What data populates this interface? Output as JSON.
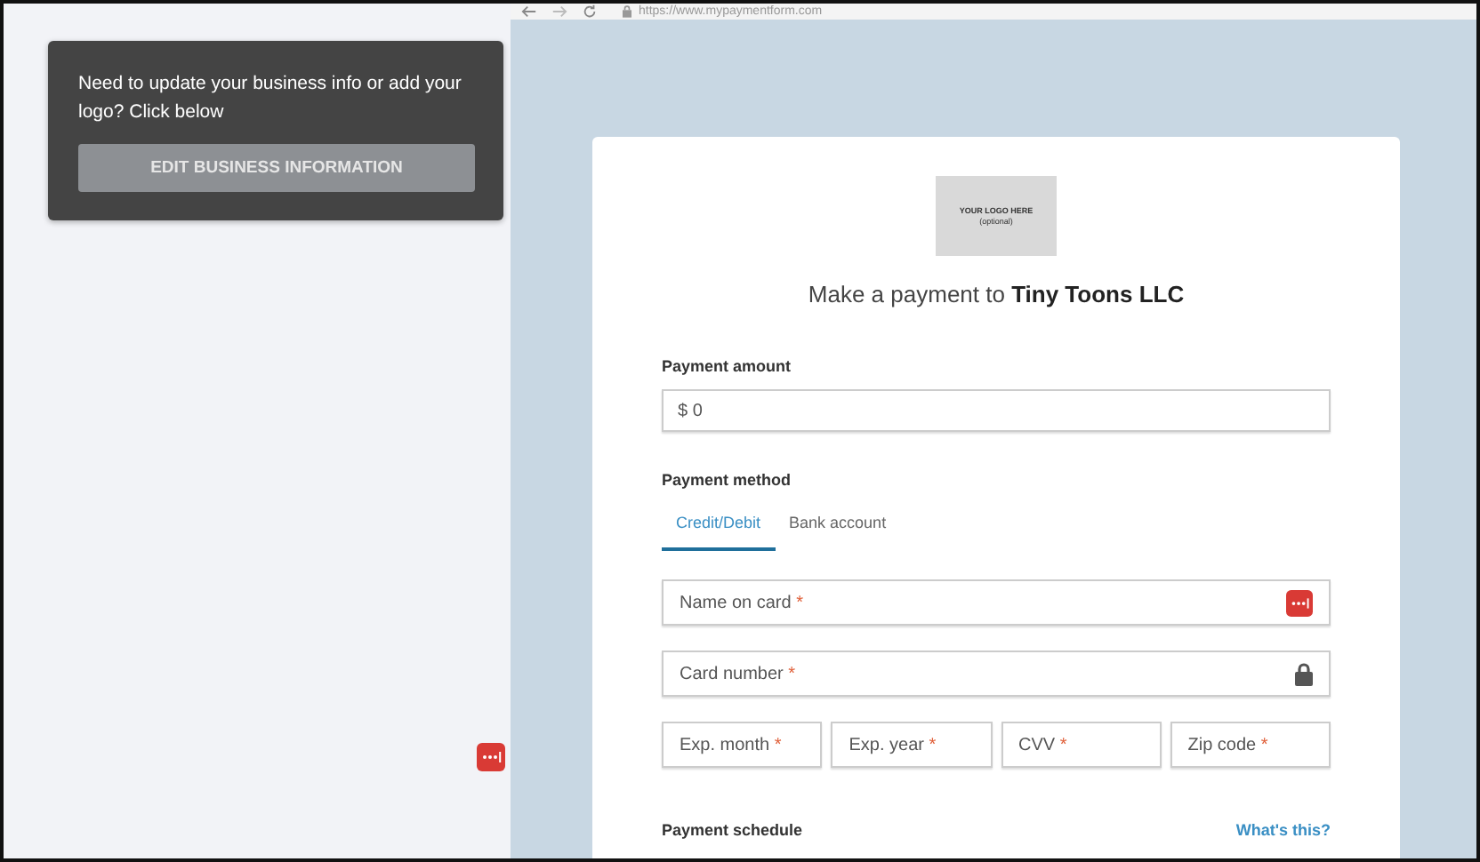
{
  "browser": {
    "url": "https://www.mypaymentform.com"
  },
  "info_panel": {
    "message": "Need to update your business info or add your logo? Click below",
    "button": "EDIT BUSINESS INFORMATION"
  },
  "form": {
    "logo_lines": [
      "YOUR LOGO HERE",
      "(optional)"
    ],
    "heading": "Make a payment to **Tiny Toons LLC**",
    "amount_label": "Payment amount",
    "amount_value": "$ 0",
    "method_label": "Payment method",
    "tabs": [
      {
        "label": "Credit/Debit",
        "selected": true
      },
      {
        "label": "Bank account",
        "selected": false
      }
    ],
    "card_fields": [
      {
        "placeholder": "Name on card",
        "mark": "*",
        "kind": "name"
      },
      {
        "placeholder": "Card number",
        "mark": "*",
        "kind": "secure"
      }
    ],
    "small_fields": [
      {
        "placeholder": "Exp. month",
        "mark": "*"
      },
      {
        "placeholder": "Exp. year",
        "mark": "*"
      },
      {
        "placeholder": "CVV",
        "mark": "*"
      },
      {
        "placeholder": "Zip code",
        "mark": "*"
      }
    ],
    "schedule_label": "Payment schedule",
    "help_link": "What's this?"
  }
}
